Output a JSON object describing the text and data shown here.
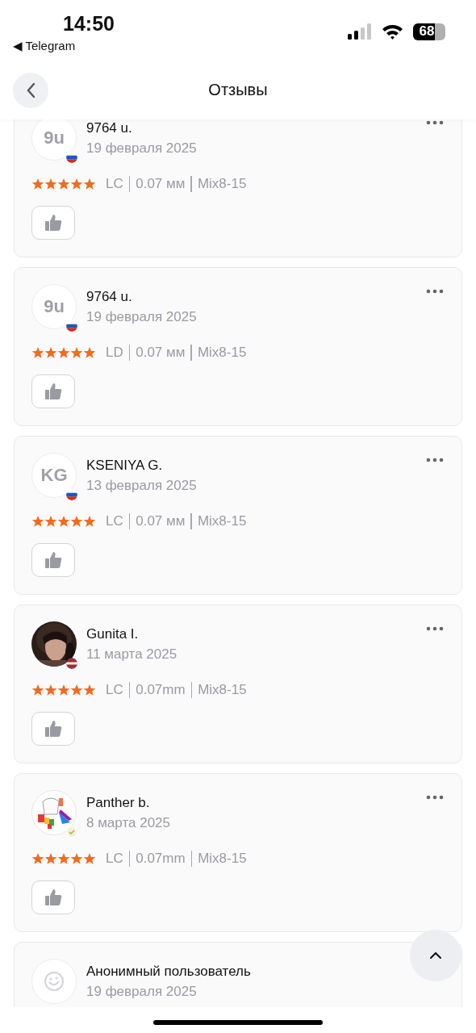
{
  "status_bar": {
    "time": "14:50",
    "back_app": "◀ Telegram",
    "battery": "68"
  },
  "header": {
    "title": "Отзывы"
  },
  "reviews": [
    {
      "avatar": {
        "kind": "initials",
        "text": "9u"
      },
      "flag": {
        "kind": "russia"
      },
      "name": "9764 u.",
      "date": "19 февраля 2025",
      "stars": 5,
      "specs": [
        "LC",
        "0.07 мм",
        "Mix8-15"
      ],
      "liked": false
    },
    {
      "avatar": {
        "kind": "initials",
        "text": "9u"
      },
      "flag": {
        "kind": "russia"
      },
      "name": "9764 u.",
      "date": "19 февраля 2025",
      "stars": 5,
      "specs": [
        "LD",
        "0.07 мм",
        "Mix8-15"
      ],
      "liked": false
    },
    {
      "avatar": {
        "kind": "initials",
        "text": "KG"
      },
      "flag": {
        "kind": "russia"
      },
      "name": "KSENIYA G.",
      "date": "13 февраля 2025",
      "stars": 5,
      "specs": [
        "LC",
        "0.07 мм",
        "Mix8-15"
      ],
      "liked": false
    },
    {
      "flag": {
        "kind": "latvia"
      },
      "name": "Gunita I.",
      "date": "11 марта 2025",
      "stars": 5,
      "specs": [
        "LC",
        "0.07mm",
        "Mix8-15"
      ],
      "liked": false
    },
    {
      "avatar": {
        "kind": "drawing"
      },
      "flag": {
        "kind": "badge"
      },
      "name": "Panther b.",
      "date": "8 марта 2025",
      "stars": 5,
      "specs": [
        "LC",
        "0.07mm",
        "Mix8-15"
      ],
      "liked": false
    },
    {
      "avatar": {
        "kind": "anonymous"
      },
      "name": "Анонимный пользователь",
      "date": "19 февраля 2025"
    }
  ]
}
